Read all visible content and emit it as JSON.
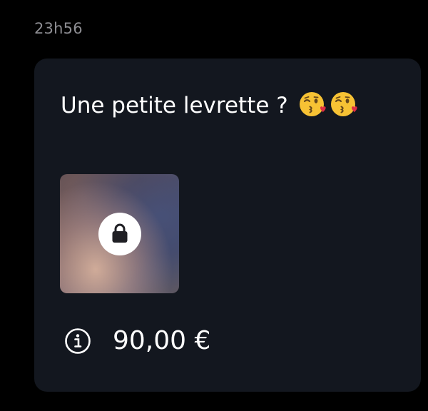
{
  "message": {
    "timestamp": "23h56",
    "text": "Une petite levrette ?",
    "emojis": [
      "kissing-face-with-heart",
      "kissing-face-with-heart"
    ],
    "media": {
      "locked": true,
      "icon": "lock-icon"
    },
    "price": "90,00 €",
    "info_icon": "info-icon"
  },
  "colors": {
    "page_background": "#000000",
    "bubble_background": "#13171f",
    "timestamp_text": "#8e8e93",
    "message_text": "#ffffff"
  }
}
